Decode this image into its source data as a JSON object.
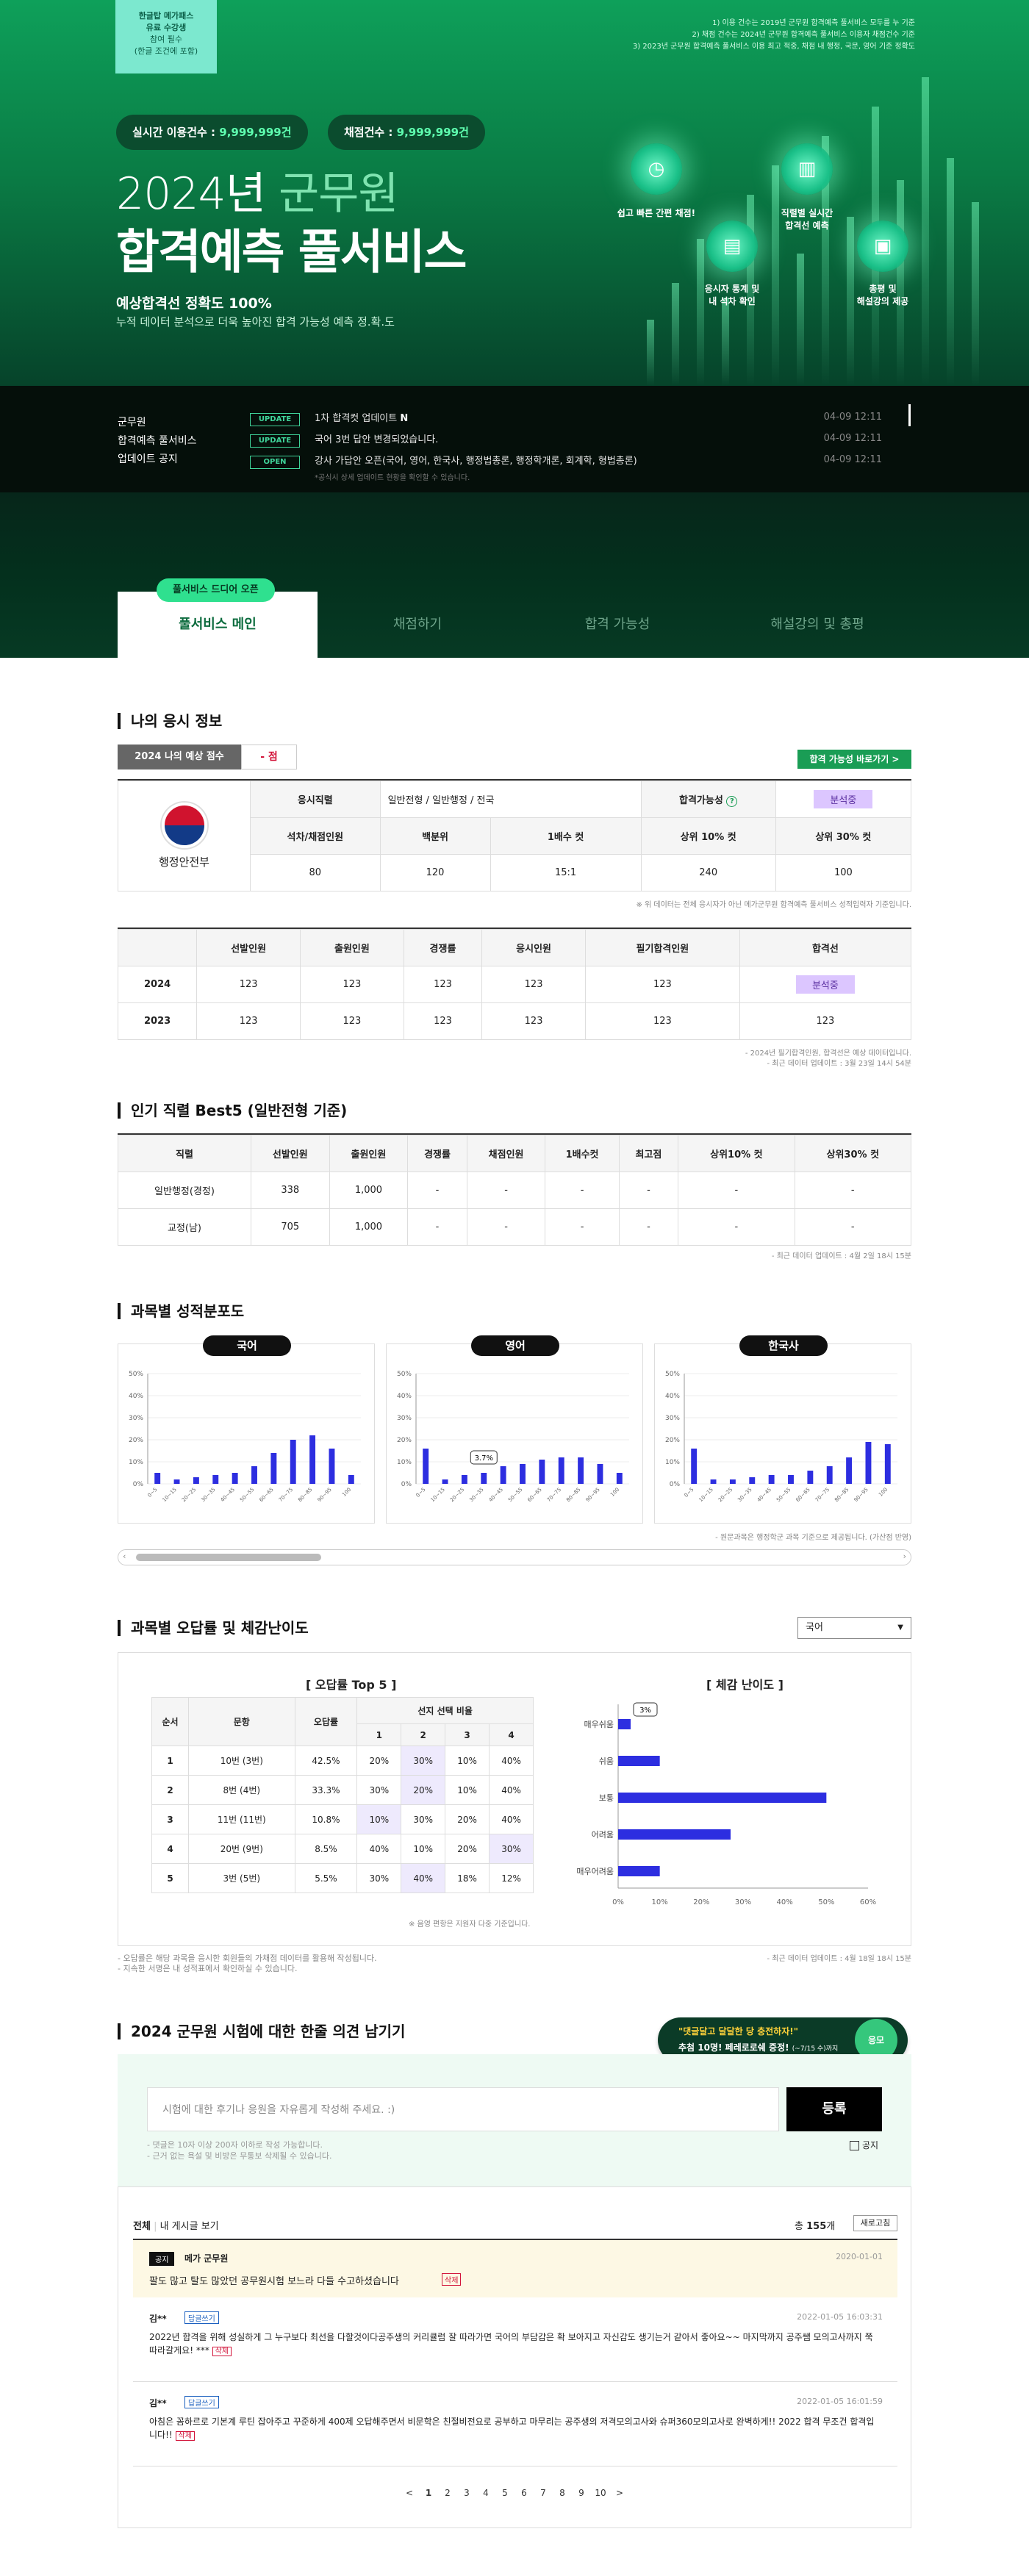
{
  "hero": {
    "badge_lines": [
      "한글탑 메가패스",
      "유료 수강생",
      "참여 필수",
      "(한글 조건에 포함)"
    ],
    "pill_realtime_label": "실시간 이용건수 :",
    "pill_realtime_value": "9,999,999건",
    "pill_grade_label": "채점건수 :",
    "pill_grade_value": "9,999,999건",
    "title_year": "2024년",
    "title_group": "군무원",
    "title_main": "합격예측 풀서비스",
    "sub_accuracy": "예상합격선 정확도 100%",
    "sub_desc": "누적 데이터 분석으로 더욱 높아진 합격 가능성 예측 정.확.도",
    "top_notes": [
      "1) 이용 건수는 2019년 군무원 합격예측 풀서비스 모두를 누 기준",
      "2) 채점 건수는 2024년 군무원 합격예측 풀서비스 이용자 채점건수 기준",
      "3) 2023년 군무원 합격예측 풀서비스 이용 최고 적중, 채점 내 행정, 국문, 영어 기준 정확도"
    ],
    "circles": [
      {
        "icon": "timer-icon",
        "glyph": "◷",
        "label": "쉽고 빠른 간편 채점!"
      },
      {
        "icon": "chart-icon",
        "glyph": "▥",
        "label": "직렬별 실시간|합격선 예측"
      },
      {
        "icon": "document-icon",
        "glyph": "▤",
        "label": "응시자 통계 및|내 석차 확인"
      },
      {
        "icon": "lecture-icon",
        "glyph": "▣",
        "label": "총평 및|해설강의 제공"
      }
    ]
  },
  "updates": {
    "label_lines": [
      "군무원",
      "합격예측 풀서비스",
      "업데이트 공지"
    ],
    "items": [
      {
        "tag": "UPDATE",
        "text": "1차 합격컷 업데이트",
        "new": "N",
        "date": "04-09 12:11"
      },
      {
        "tag": "UPDATE",
        "text": "국어 3번 답안 변경되었습니다.",
        "new": "",
        "date": "04-09 12:11"
      },
      {
        "tag": "OPEN",
        "text": "강사 가답안 오픈(국어, 영어, 한국사, 행정법총론, 행정학개론, 회계학, 형법총론)",
        "new": "",
        "date": "04-09 12:11"
      }
    ],
    "footnote": "*공식시 상세 업데이트 현황을 확인할 수 있습니다."
  },
  "tabs": {
    "badge": "풀서비스 드디어 오픈",
    "items": [
      "풀서비스 메인",
      "채점하기",
      "합격 가능성",
      "해설강의 및 총평"
    ]
  },
  "my_info": {
    "section_title": "나의 응시 정보",
    "score_label": "2024 나의 예상 점수",
    "score_value": "- 점",
    "possibility_button": "합격 가능성 바로가기 >",
    "org_name": "행정안전부",
    "row1": {
      "h1": "응시직렬",
      "v1": "일반전형 / 일반행정 / 전국",
      "h2": "합격가능성",
      "v2": "분석중"
    },
    "headers2": [
      "석차/채점인원",
      "백분위",
      "1배수 컷",
      "상위 10% 컷",
      "상위 30% 컷"
    ],
    "values2": [
      "80",
      "120",
      "15:1",
      "240",
      "100"
    ],
    "note": "※ 위 데이터는 전체 응시자가 아닌 메가군무원 합격예측 풀서비스 성적입력자 기준입니다."
  },
  "year_table": {
    "headers": [
      "",
      "선발인원",
      "출원인원",
      "경쟁률",
      "응시인원",
      "필기합격인원",
      "합격선"
    ],
    "rows": [
      [
        "2024",
        "123",
        "123",
        "123",
        "123",
        "123",
        "분석중"
      ],
      [
        "2023",
        "123",
        "123",
        "123",
        "123",
        "123",
        "123"
      ]
    ],
    "notes": [
      "- 2024년 필기합격인원, 합격선은 예상 데이터입니다.",
      "- 최근 데이터 업데이트 : 3월 23일 14시 54분"
    ]
  },
  "best5": {
    "section_title": "인기 직렬 Best5 (일반전형 기준)",
    "headers": [
      "직렬",
      "선발인원",
      "출원인원",
      "경쟁률",
      "채점인원",
      "1배수컷",
      "최고점",
      "상위10% 컷",
      "상위30% 컷"
    ],
    "rows": [
      [
        "일반행정(경정)",
        "338",
        "1,000",
        "-",
        "-",
        "-",
        "-",
        "-",
        "-"
      ],
      [
        "교정(남)",
        "705",
        "1,000",
        "-",
        "-",
        "-",
        "-",
        "-",
        "-"
      ]
    ],
    "note": "- 최근 데이터 업데이트 : 4월 2일 18시 15분"
  },
  "dist": {
    "section_title": "과목별 성적분포도",
    "note": "- 원문과목은 행정학군 과목 기준으로 제공됩니다. (가산점 반영)"
  },
  "chart_data": [
    {
      "type": "bar",
      "title": "국어",
      "categories": [
        "0~5",
        "10~15",
        "20~25",
        "30~35",
        "40~45",
        "50~55",
        "60~65",
        "70~75",
        "80~85",
        "90~95",
        "100"
      ],
      "values": [
        5,
        2,
        3,
        4,
        5,
        8,
        14,
        20,
        22,
        16,
        4
      ],
      "ylim": [
        0,
        50
      ],
      "yticks": [
        "0%",
        "10%",
        "20%",
        "30%",
        "40%",
        "50%"
      ]
    },
    {
      "type": "bar",
      "title": "영어",
      "categories": [
        "0~5",
        "10~15",
        "20~25",
        "30~35",
        "40~45",
        "50~55",
        "60~65",
        "70~75",
        "80~85",
        "90~95",
        "100"
      ],
      "values": [
        16,
        2,
        4,
        5,
        8,
        9,
        11,
        12,
        12,
        9,
        5
      ],
      "annotation": "3.7%",
      "ylim": [
        0,
        50
      ],
      "yticks": [
        "0%",
        "10%",
        "20%",
        "30%",
        "40%",
        "50%"
      ]
    },
    {
      "type": "bar",
      "title": "한국사",
      "categories": [
        "0~5",
        "10~15",
        "20~25",
        "30~35",
        "40~45",
        "50~55",
        "60~65",
        "70~75",
        "80~85",
        "90~95",
        "100"
      ],
      "values": [
        16,
        2,
        2,
        3,
        4,
        4,
        6,
        8,
        12,
        19,
        18
      ],
      "ylim": [
        0,
        50
      ],
      "yticks": [
        "0%",
        "10%",
        "20%",
        "30%",
        "40%",
        "50%"
      ]
    },
    {
      "type": "bar",
      "title": "[ 체감 난이도 ]",
      "orientation": "horizontal",
      "categories": [
        "매우쉬움",
        "쉬움",
        "보통",
        "어려움",
        "매우어려움"
      ],
      "values": [
        3,
        10,
        50,
        27,
        10
      ],
      "annotation": "3%",
      "xlim": [
        0,
        60
      ],
      "xticks": [
        "0%",
        "10%",
        "20%",
        "30%",
        "40%",
        "50%",
        "60%"
      ]
    }
  ],
  "err": {
    "section_title": "과목별 오답률 및 체감난이도",
    "select_value": "국어",
    "top5_title": "[ 오답률 Top 5 ]",
    "headers": [
      "순서",
      "문항",
      "오답률",
      "선지 선택 비율"
    ],
    "choice_headers": [
      "1",
      "2",
      "3",
      "4"
    ],
    "rows": [
      [
        "1",
        "10번 (3번)",
        "42.5%",
        "20%",
        "30%",
        "10%",
        "40%"
      ],
      [
        "2",
        "8번 (4번)",
        "33.3%",
        "30%",
        "20%",
        "10%",
        "40%"
      ],
      [
        "3",
        "11번 (11번)",
        "10.8%",
        "10%",
        "30%",
        "20%",
        "40%"
      ],
      [
        "4",
        "20번 (9번)",
        "8.5%",
        "40%",
        "10%",
        "20%",
        "30%"
      ],
      [
        "5",
        "3번 (5번)",
        "5.5%",
        "30%",
        "40%",
        "18%",
        "12%"
      ]
    ],
    "table_note": "※ 음영 편항은 지원자 다중 기준입니다.",
    "left_notes": [
      "- 오답률은 해당 과목을 응시한 회원들의 가채점 데이터를 활용해 작성됩니다.",
      "- 지속한 서명은 내 성적표에서 확인하실 수 있습니다."
    ],
    "right_note": "- 최근 데이터 업데이트 : 4월 18일 18시 15분"
  },
  "comment": {
    "section_title": "2024 군무원 시험에 대한 한줄 의견 남기기",
    "promo_line1": "\"댓글달고 달달한 당 충전하자!\"",
    "promo_line2": "추첨 10명! 페레로로쉐 증정!",
    "promo_small": "(~7/15 수)까지",
    "promo_stamp": "응모",
    "placeholder": "시험에 대한 후기나 응원을 자유롭게 작성해 주세요. :)",
    "submit": "등록",
    "rules": [
      "- 댓글은 10자 이상 200자 이하로 작성 가능합니다.",
      "- 근거 없는 욕설 및 비방은 무통보 삭제될 수 있습니다."
    ],
    "notice_check": "공지"
  },
  "board": {
    "filter_all": "전체",
    "filter_mine": "내 게시글 보기",
    "total_prefix": "총",
    "total_count": "155",
    "total_suffix": "개",
    "refresh": "새로고침",
    "posts": [
      {
        "badge": "공지",
        "author": "메가 군무원",
        "date": "2020-01-01",
        "text": "팔도 많고 탈도 많았던 공무원시험 보느라 다들 수고하셨습니다",
        "del": "삭제"
      },
      {
        "author": "김**",
        "reply": "답글쓰기",
        "date": "2022-01-05 16:03:31",
        "text": "2022년 합격을 위해 성실하게 그 누구보다 최선을 다할것이다공주생의 커리큘럼 잘 따라가면 국어의 부담감은 확 보아지고 자신감도 생기는거 같아서 좋아요~~ 마지막까지 공주쌤 모의고사까지 쭉 따라갈게요! ***",
        "del": "삭제"
      },
      {
        "author": "김**",
        "reply": "답글쓰기",
        "date": "2022-01-05 16:01:59",
        "text": "아침은 꼼하르로 기본계 루틴 잡아주고 꾸준하게 400제 오답해주면서 비문학은 친절비전요로 공부하고 마무리는 공주생의 저격모의고사와 슈퍼360모의고사로 완벽하게!! 2022 합격 무조건 합격입니다!!",
        "del": "삭제"
      }
    ],
    "pages": [
      "<",
      "1",
      "2",
      "3",
      "4",
      "5",
      "6",
      "7",
      "8",
      "9",
      "10",
      ">"
    ]
  },
  "colors": {
    "brand": "#0a8d4d",
    "bar": "#2d2ee0",
    "accent": "#2fe08f"
  }
}
